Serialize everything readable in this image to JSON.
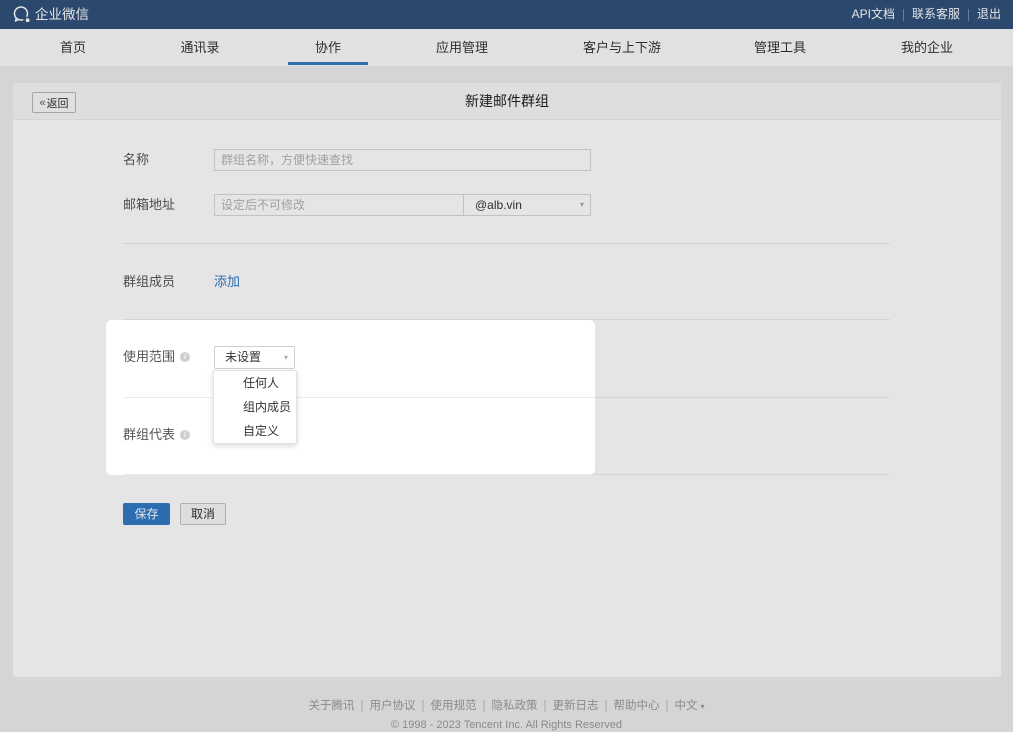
{
  "topbar": {
    "brand": "企业微信",
    "links": [
      "API文档",
      "联系客服",
      "退出"
    ]
  },
  "nav": {
    "items": [
      "首页",
      "通讯录",
      "协作",
      "应用管理",
      "客户与上下游",
      "管理工具",
      "我的企业"
    ],
    "active_index": 2
  },
  "panel": {
    "back_label": "返回",
    "title": "新建邮件群组"
  },
  "form": {
    "name": {
      "label": "名称",
      "placeholder": "群组名称，方便快速查找"
    },
    "email": {
      "label": "邮箱地址",
      "placeholder": "设定后不可修改",
      "domain": "@alb.vin"
    },
    "members": {
      "label": "群组成员",
      "add_label": "添加"
    },
    "scope": {
      "label": "使用范围",
      "selected": "未设置",
      "options": [
        "任何人",
        "组内成员",
        "自定义"
      ]
    },
    "representative": {
      "label": "群组代表"
    },
    "save_label": "保存",
    "cancel_label": "取消"
  },
  "footer": {
    "links": [
      "关于腾讯",
      "用户协议",
      "使用规范",
      "隐私政策",
      "更新日志",
      "帮助中心",
      "中文"
    ],
    "copyright": "© 1998 - 2023 Tencent Inc. All Rights Reserved"
  },
  "icons": {
    "logo": "wecom-logo-icon",
    "back": "double-chevron-left-icon",
    "select_arrow": "caret-down-icon",
    "info": "info-circle-icon"
  },
  "colors": {
    "topbar_bg": "#30527b",
    "nav_bg": "#fbfbfb",
    "page_bg": "#eeeeee",
    "accent": "#3279c5",
    "overlay": "rgba(0,0,0,0.1)"
  }
}
